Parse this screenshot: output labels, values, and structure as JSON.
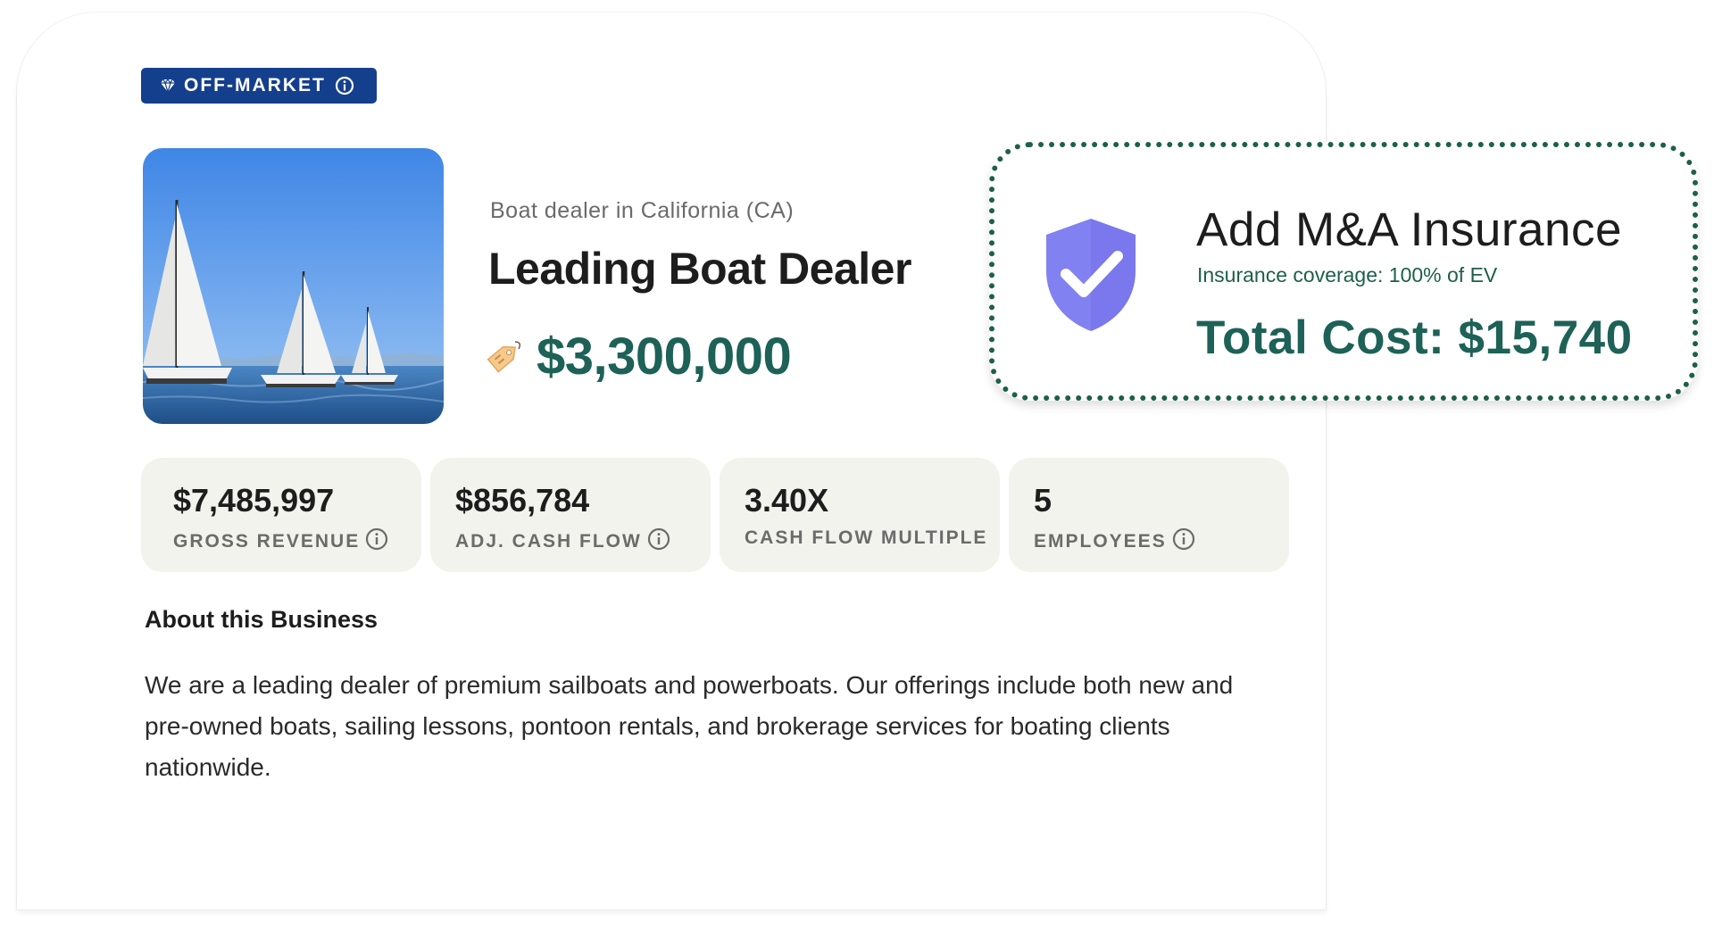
{
  "badge": {
    "label": "OFF-MARKET",
    "icons": [
      "diamond-icon",
      "info-icon"
    ]
  },
  "listing": {
    "subtitle": "Boat dealer in California (CA)",
    "title": "Leading Boat Dealer",
    "price": "$3,300,000",
    "price_icon": "price-tag-icon",
    "image": "sailboats-photo"
  },
  "stats": [
    {
      "value": "$7,485,997",
      "label": "GROSS REVENUE",
      "has_info": true
    },
    {
      "value": "$856,784",
      "label": "ADJ. CASH FLOW",
      "has_info": true
    },
    {
      "value": "3.40X",
      "label": "CASH FLOW MULTIPLE",
      "has_info": false
    },
    {
      "value": "5",
      "label": "EMPLOYEES",
      "has_info": true
    }
  ],
  "about": {
    "heading": "About this Business",
    "text": "We are a leading dealer of premium sailboats and powerboats. Our offerings include both new and pre-owned boats, sailing lessons, pontoon rentals, and brokerage services for boating clients nationwide."
  },
  "insurance": {
    "title": "Add M&A Insurance",
    "subtitle": "Insurance coverage: 100% of EV",
    "cost": "Total Cost: $15,740",
    "icon": "shield-check-icon"
  },
  "colors": {
    "badge_bg": "#143f8c",
    "price_green": "#1d6157",
    "stat_bg": "#f1f3ec",
    "shield": "#8281f2",
    "dotted_border": "#1d5f49"
  }
}
